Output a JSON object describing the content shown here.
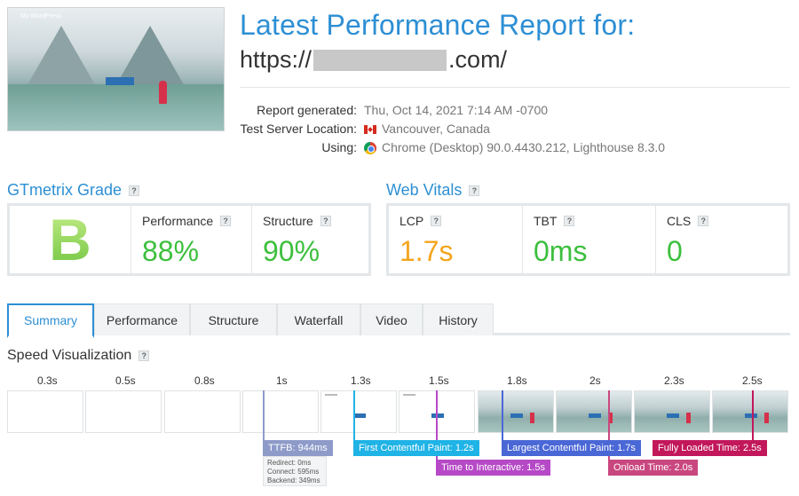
{
  "thumbnail": {
    "site_title": "My WordPress"
  },
  "header": {
    "title": "Latest Performance Report for:",
    "url_prefix": "https://",
    "url_suffix": ".com/"
  },
  "report_meta": {
    "labels": [
      "Report generated:",
      "Test Server Location:",
      "Using:"
    ],
    "generated": "Thu, Oct 14, 2021 7:14 AM -0700",
    "location": "Vancouver, Canada",
    "using": "Chrome (Desktop) 90.0.4430.212, Lighthouse 8.3.0"
  },
  "gtmetrix": {
    "heading": "GTmetrix Grade",
    "grade": "B",
    "performance_label": "Performance",
    "performance_value": "88%",
    "structure_label": "Structure",
    "structure_value": "90%"
  },
  "web_vitals": {
    "heading": "Web Vitals",
    "lcp_label": "LCP",
    "lcp_value": "1.7s",
    "tbt_label": "TBT",
    "tbt_value": "0ms",
    "cls_label": "CLS",
    "cls_value": "0"
  },
  "help_glyph": "?",
  "tabs": [
    "Summary",
    "Performance",
    "Structure",
    "Waterfall",
    "Video",
    "History"
  ],
  "active_tab": "Summary",
  "speed_viz": {
    "heading": "Speed Visualization",
    "ticks": [
      "0.3s",
      "0.5s",
      "0.8s",
      "1s",
      "1.3s",
      "1.5s",
      "1.8s",
      "2s",
      "2.3s",
      "2.5s"
    ],
    "markers": {
      "ttfb": "TTFB: 944ms",
      "fcp": "First Contentful Paint: 1.2s",
      "tti": "Time to Interactive: 1.5s",
      "lcp": "Largest Contentful Paint: 1.7s",
      "onload": "Onload Time: 2.0s",
      "fully_loaded": "Fully Loaded Time: 2.5s"
    },
    "ttfb_details": [
      "Redirect: 0ms",
      "Connect: 595ms",
      "Backend: 349ms"
    ]
  },
  "colors": {
    "accent": "#2d8fd4",
    "good": "#3dbf3d",
    "average": "#f4a51c",
    "ttfb": "#8e9bc9",
    "fcp": "#1fb3e6",
    "tti": "#b549c6",
    "lcp": "#4a67d6",
    "onload": "#c9477f",
    "fully_loaded": "#c2185b"
  }
}
